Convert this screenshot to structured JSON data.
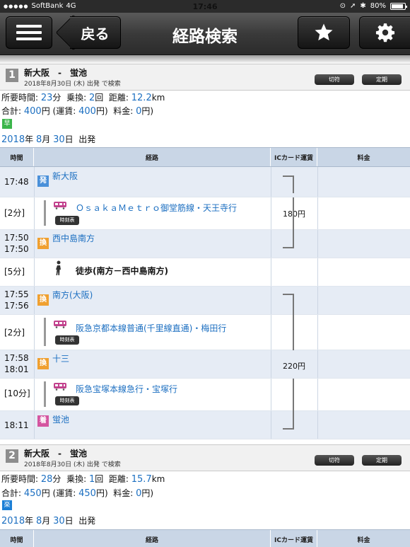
{
  "status_bar": {
    "dots": "●●●●●",
    "carrier": "SoftBank",
    "network": "4G",
    "time": "17:46",
    "battery": "80%",
    "battery_level": 0.8
  },
  "nav": {
    "back_label": "戻る",
    "title": "経路検索"
  },
  "table_header": {
    "time": "時間",
    "route": "経路",
    "ic_fare": "ICカード運賃",
    "fee": "料金"
  },
  "routes": [
    {
      "number": "1",
      "name": "新大阪　-　蛍池",
      "date": "2018年8月30日 (木)  出発 で検索",
      "teiki_label": "切符",
      "pass_label": "定期",
      "summary": {
        "duration_label": "所要時間:",
        "duration_value": "23",
        "duration_unit": "分",
        "transfers_label": "乗換:",
        "transfers_value": "2",
        "transfers_unit": "回",
        "distance_label": "距離:",
        "distance_value": "12.2",
        "distance_unit": "km",
        "total_label": "合計:",
        "total_value": "400",
        "total_unit": "円",
        "fare_label": "(運賃:",
        "fare_value": "400",
        "fare_unit": "円)",
        "charge_label": "料金:",
        "charge_value": "0",
        "charge_unit": "円)",
        "badge": "早",
        "badge_color": "#3bb54a"
      },
      "departure": {
        "year": "2018",
        "year_unit": "年",
        "month": "8",
        "month_unit": "月",
        "day": "30",
        "day_unit": "日",
        "label": "出発"
      },
      "rows": {
        "s1_time": "17:48",
        "s1_icon": "発",
        "s1_name": "新大阪",
        "seg1_time": "[2分]",
        "seg1_line": "ＯｓａｋａＭｅｔｒｏ御堂筋線・天王寺行",
        "seg1_timetable": "時刻表",
        "seg1_fare": "180円",
        "s2_time_arr": "17:50",
        "s2_time_dep": "17:50",
        "s2_icon": "換",
        "s2_name": "西中島南方",
        "seg2_time": "[5分]",
        "seg2_walk": "徒歩(南方－西中島南方)",
        "s3_time_arr": "17:55",
        "s3_time_dep": "17:56",
        "s3_icon": "換",
        "s3_name": "南方(大阪)",
        "seg3_time": "[2分]",
        "seg3_line": "阪急京都本線普通(千里線直通)・梅田行",
        "seg3_timetable": "時刻表",
        "s4_time_arr": "17:58",
        "s4_time_dep": "18:01",
        "s4_icon": "換",
        "s4_name": "十三",
        "s4_fare": "220円",
        "seg4_time": "[10分]",
        "seg4_line": "阪急宝塚本線急行・宝塚行",
        "seg4_timetable": "時刻表",
        "s5_time": "18:11",
        "s5_icon": "着",
        "s5_name": "蛍池"
      }
    },
    {
      "number": "2",
      "name": "新大阪　-　蛍池",
      "date": "2018年8月30日 (木)  出発 で検索",
      "teiki_label": "切符",
      "pass_label": "定期",
      "summary": {
        "duration_label": "所要時間:",
        "duration_value": "28",
        "duration_unit": "分",
        "transfers_label": "乗換:",
        "transfers_value": "1",
        "transfers_unit": "回",
        "distance_label": "距離:",
        "distance_value": "15.7",
        "distance_unit": "km",
        "total_label": "合計:",
        "total_value": "450",
        "total_unit": "円",
        "fare_label": "(運賃:",
        "fare_value": "450",
        "fare_unit": "円)",
        "charge_label": "料金:",
        "charge_value": "0",
        "charge_unit": "円)",
        "badge": "楽",
        "badge_color": "#1c7fd6"
      },
      "departure": {
        "year": "2018",
        "year_unit": "年",
        "month": "8",
        "month_unit": "月",
        "day": "30",
        "day_unit": "日",
        "label": "出発"
      }
    }
  ],
  "colors": {
    "dep_icon": "#4a90d9",
    "transfer_icon": "#f0a030",
    "arr_icon": "#d455a0",
    "accent_blue": "#1c6fc1"
  }
}
